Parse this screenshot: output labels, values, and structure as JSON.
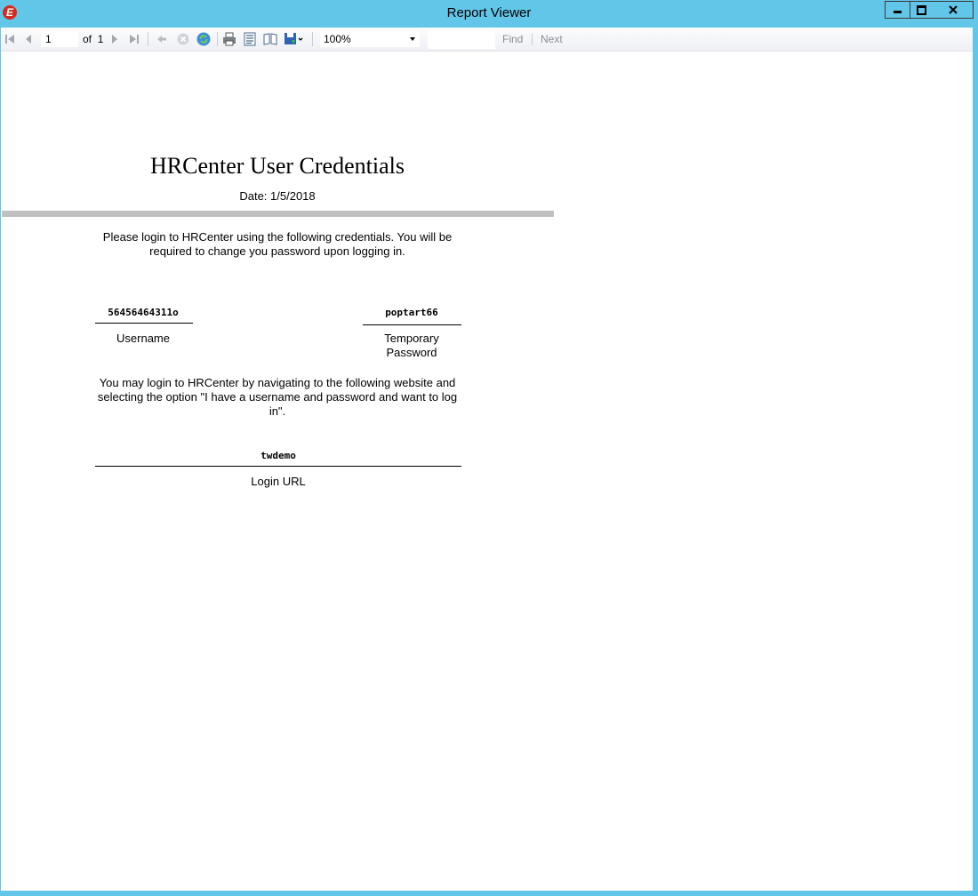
{
  "window": {
    "title": "Report Viewer",
    "icon_letter": "E"
  },
  "toolbar": {
    "page_current": "1",
    "page_of": "of",
    "page_total": "1",
    "zoom": "100%",
    "find_value": "",
    "find_label": "Find",
    "next_label": "Next"
  },
  "report": {
    "title": "HRCenter User Credentials",
    "date": "Date: 1/5/2018",
    "intro": "Please login to HRCenter using the following credentials.  You  will be required to change you password upon logging in.",
    "username_value": "56456464311o",
    "username_label": "Username",
    "password_value": "poptart66",
    "password_label_line1": "Temporary",
    "password_label_line2": "Password",
    "navigate_text": "You may login to HRCenter by navigating to the following website and selecting the option \"I have a username and password and want to log in\".",
    "url_value": "twdemo",
    "url_label": "Login URL"
  },
  "colors": {
    "frame": "#62c6e8",
    "separator_bar": "#c0c0c0",
    "app_icon": "#d52b1e"
  }
}
